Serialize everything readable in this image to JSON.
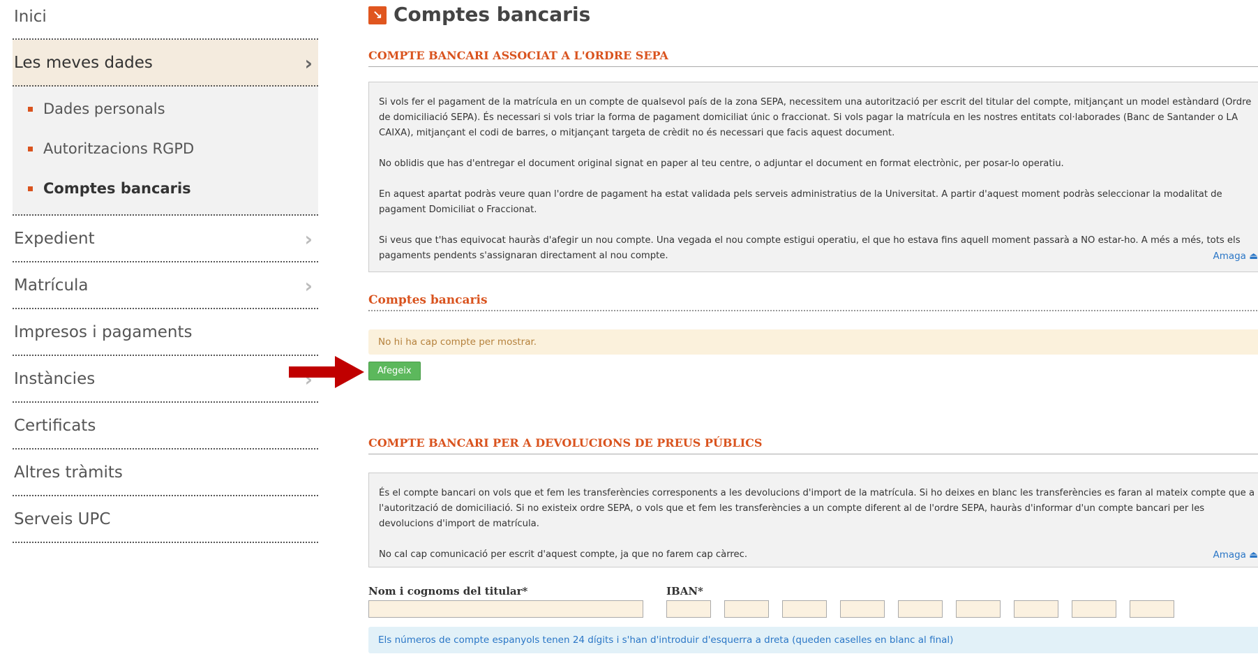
{
  "sidebar": {
    "items": [
      {
        "label": "Inici"
      },
      {
        "label": "Les meves dades"
      },
      {
        "label": "Expedient"
      },
      {
        "label": "Matrícula"
      },
      {
        "label": "Impresos i pagaments"
      },
      {
        "label": "Instàncies"
      },
      {
        "label": "Certificats"
      },
      {
        "label": "Altres tràmits"
      },
      {
        "label": "Serveis UPC"
      }
    ],
    "subitems": [
      {
        "label": "Dades personals"
      },
      {
        "label": "Autoritzacions RGPD"
      },
      {
        "label": "Comptes bancaris"
      }
    ]
  },
  "main": {
    "title": "Comptes bancaris",
    "sepa_section": {
      "heading": "COMPTE BANCARI ASSOCIAT A L'ORDRE SEPA",
      "paragraphs": [
        "Si vols fer el pagament de la matrícula en un compte de qualsevol país de la zona SEPA, necessitem una autorització per escrit del titular del compte, mitjançant un model estàndard (Ordre de domiciliació SEPA). És necessari si vols triar la forma de pagament domiciliat únic o fraccionat. Si vols pagar la matrícula en les nostres entitats col·laborades (Banc de Santander o LA CAIXA), mitjançant el codi de barres, o mitjançant targeta de crèdit no és necessari que facis aquest document.",
        "No oblidis que has d'entregar el document original signat en paper al teu centre, o adjuntar el document en format electrònic, per posar-lo operatiu.",
        "En aquest apartat podràs veure quan l'ordre de pagament ha estat validada pels serveis administratius de la Universitat. A partir d'aquest moment podràs seleccionar la modalitat de pagament Domiciliat o Fraccionat.",
        "Si veus que t'has equivocat hauràs d'afegir un nou compte. Una vegada el nou compte estigui operatiu, el que ho estava fins aquell moment passarà a NO estar-ho. A més a més, tots els pagaments pendents s'assignaran directament al nou compte."
      ],
      "hide_label": "Amaga ⏏"
    },
    "accounts": {
      "heading": "Comptes bancaris",
      "empty_notice": "No hi ha cap compte per mostrar.",
      "add_button": "Afegeix"
    },
    "refund_section": {
      "heading": "COMPTE BANCARI PER A DEVOLUCIONS DE PREUS PÚBLICS",
      "paragraphs": [
        "És el compte bancari on vols que et fem les transferències corresponents a les devolucions d'import de la matrícula. Si ho deixes en blanc les transferències es faran al mateix compte que a l'autorització de domiciliació. Si no existeix ordre SEPA, o vols que et fem les transferències a un compte diferent al de l'ordre SEPA, hauràs d'informar d'un compte bancari per les devolucions d'import de matrícula.",
        "No cal cap comunicació per escrit d'aquest compte, ja que no farem cap càrrec."
      ],
      "hide_label": "Amaga ⏏"
    },
    "form": {
      "holder_label": "Nom i cognoms del titular*",
      "iban_label": "IBAN*",
      "help": "Els números de compte espanyols tenen 24 dígits i s'han d'introduir d'esquerra a dreta (queden caselles en blanc al final)"
    }
  },
  "icons": {
    "title_icon": "↘",
    "chevron": "›"
  },
  "colors": {
    "accent": "#d9531e",
    "active_bg": "#f4ebde",
    "button_green": "#5cb85c",
    "link_blue": "#2a76c6",
    "arrow_red": "#c00000"
  }
}
